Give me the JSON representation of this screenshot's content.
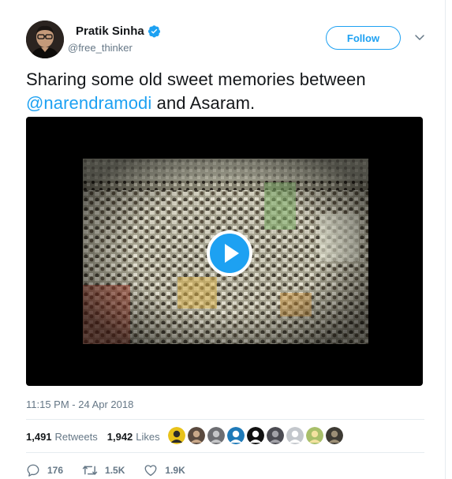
{
  "author": {
    "display_name": "Pratik Sinha",
    "handle": "@free_thinker",
    "verified": true,
    "avatar": "profile-photo-man-glasses"
  },
  "follow_label": "Follow",
  "tweet": {
    "text_before": "Sharing some old sweet memories between ",
    "mention": "@narendramodi",
    "text_after": " and Asaram."
  },
  "media": {
    "type": "video",
    "thumbnail": "crowd-at-rally",
    "play_icon": "play-icon"
  },
  "timestamp": "11:15 PM - 24 Apr 2018",
  "stats": {
    "retweets_count": "1,491",
    "retweets_label": "Retweets",
    "likes_count": "1,942",
    "likes_label": "Likes"
  },
  "likers": [
    {
      "icon": "liker-avatar-1",
      "bg": "#e8c21a",
      "fg": "#2b2b2b"
    },
    {
      "icon": "liker-avatar-2",
      "bg": "#5a4a3f",
      "fg": "#c9a889"
    },
    {
      "icon": "liker-avatar-3",
      "bg": "#6d6e72",
      "fg": "#c5c6c8"
    },
    {
      "icon": "liker-avatar-4",
      "bg": "#1f7ab8",
      "fg": "#ffffff"
    },
    {
      "icon": "liker-avatar-5",
      "bg": "#111111",
      "fg": "#ffffff"
    },
    {
      "icon": "liker-avatar-6",
      "bg": "#4b4b52",
      "fg": "#a2a2a8"
    },
    {
      "icon": "liker-avatar-7",
      "bg": "#c3c7cc",
      "fg": "#ffffff"
    },
    {
      "icon": "liker-avatar-8",
      "bg": "#a8bf6a",
      "fg": "#f3e2a0"
    },
    {
      "icon": "liker-avatar-9",
      "bg": "#3d3a33",
      "fg": "#9c8f76"
    }
  ],
  "actions": {
    "reply_count": "176",
    "retweet_count": "1.5K",
    "like_count": "1.9K"
  },
  "colors": {
    "accent": "#1da1f2",
    "text": "#14171a",
    "secondary": "#657786",
    "border": "#e6ecf0"
  }
}
